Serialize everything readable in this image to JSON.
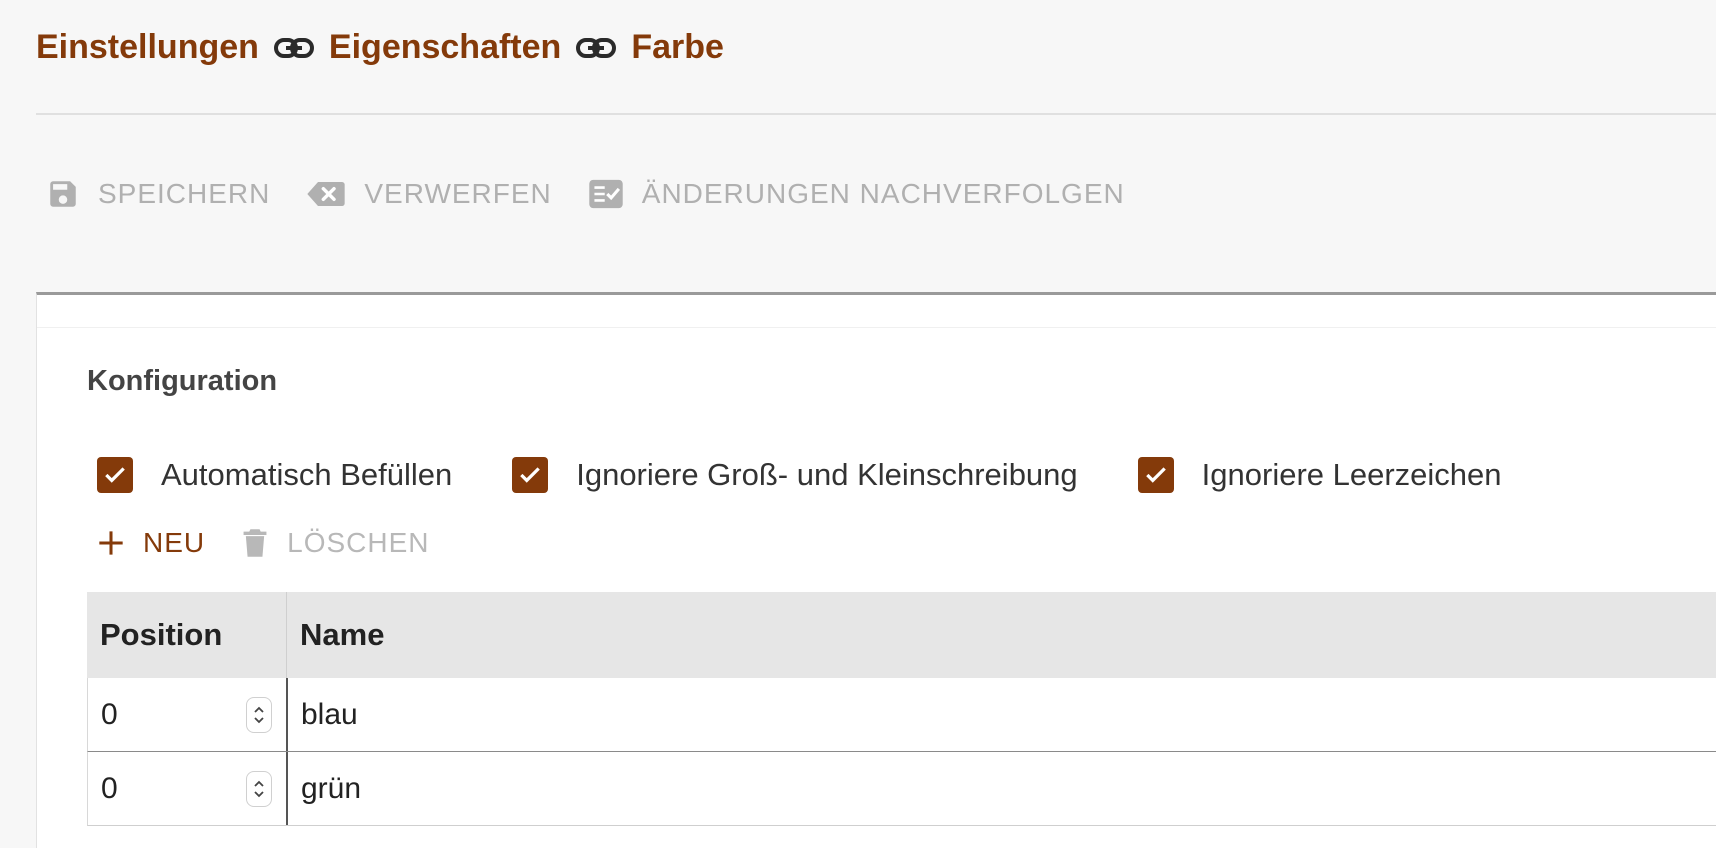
{
  "breadcrumb": {
    "items": [
      "Einstellungen",
      "Eigenschaften",
      "Farbe"
    ]
  },
  "toolbar": {
    "save_label": "SPEICHERN",
    "discard_label": "VERWERFEN",
    "track_label": "ÄNDERUNGEN NACHVERFOLGEN"
  },
  "config": {
    "title": "Konfiguration",
    "checkboxes": [
      {
        "label": "Automatisch Befüllen",
        "checked": true
      },
      {
        "label": "Ignoriere Groß- und Kleinschreibung",
        "checked": true
      },
      {
        "label": "Ignoriere Leerzeichen",
        "checked": true
      }
    ]
  },
  "actions": {
    "new_label": "NEU",
    "delete_label": "LÖSCHEN"
  },
  "table": {
    "columns": [
      "Position",
      "Name"
    ],
    "rows": [
      {
        "position": "0",
        "name": "blau"
      },
      {
        "position": "0",
        "name": "grün"
      }
    ]
  },
  "colors": {
    "accent": "#843a0a",
    "disabled": "#b0b0b0"
  }
}
